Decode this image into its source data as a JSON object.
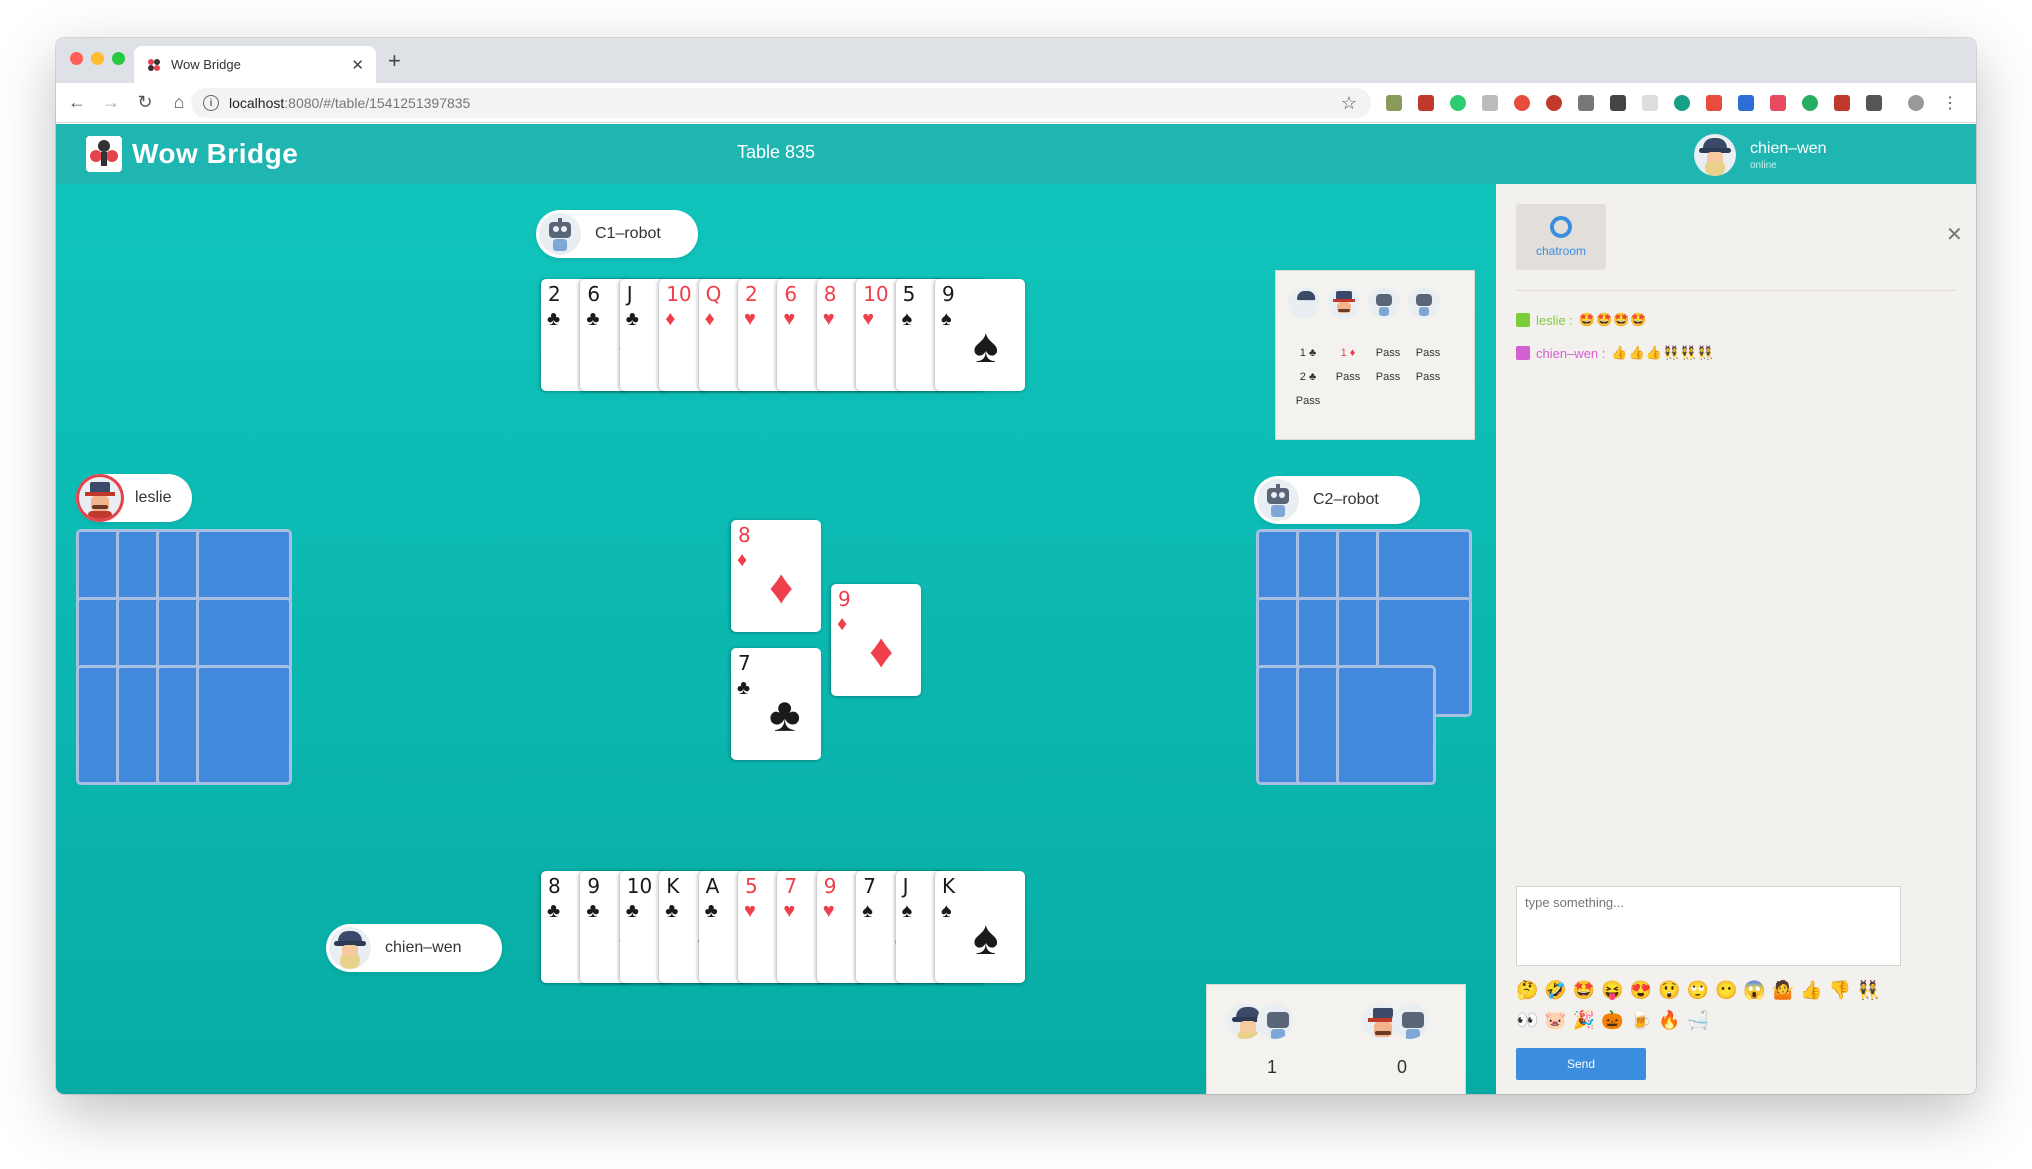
{
  "browser": {
    "tab_title": "Wow Bridge",
    "url_host": "localhost",
    "url_path": ":8080/#/table/1541251397835"
  },
  "app": {
    "logo_text": "Wow Bridge",
    "table_title": "Table 835",
    "user": {
      "name": "chien–wen",
      "status": "online"
    }
  },
  "players": {
    "north": "C1–robot",
    "west": "leslie",
    "east": "C2–robot",
    "south": "chien–wen"
  },
  "north_hand": [
    {
      "rank": "2",
      "suit": "♣",
      "color": "black"
    },
    {
      "rank": "6",
      "suit": "♣",
      "color": "black"
    },
    {
      "rank": "J",
      "suit": "♣",
      "color": "black"
    },
    {
      "rank": "10",
      "suit": "♦",
      "color": "red"
    },
    {
      "rank": "Q",
      "suit": "♦",
      "color": "red"
    },
    {
      "rank": "2",
      "suit": "♥",
      "color": "red"
    },
    {
      "rank": "6",
      "suit": "♥",
      "color": "red"
    },
    {
      "rank": "8",
      "suit": "♥",
      "color": "red"
    },
    {
      "rank": "10",
      "suit": "♥",
      "color": "red"
    },
    {
      "rank": "5",
      "suit": "♠",
      "color": "black"
    },
    {
      "rank": "9",
      "suit": "♠",
      "color": "black"
    }
  ],
  "south_hand": [
    {
      "rank": "8",
      "suit": "♣",
      "color": "black"
    },
    {
      "rank": "9",
      "suit": "♣",
      "color": "black"
    },
    {
      "rank": "10",
      "suit": "♣",
      "color": "black"
    },
    {
      "rank": "K",
      "suit": "♣",
      "color": "black"
    },
    {
      "rank": "A",
      "suit": "♣",
      "color": "black"
    },
    {
      "rank": "5",
      "suit": "♥",
      "color": "red"
    },
    {
      "rank": "7",
      "suit": "♥",
      "color": "red"
    },
    {
      "rank": "9",
      "suit": "♥",
      "color": "red"
    },
    {
      "rank": "7",
      "suit": "♠",
      "color": "black"
    },
    {
      "rank": "J",
      "suit": "♠",
      "color": "black"
    },
    {
      "rank": "K",
      "suit": "♠",
      "color": "black"
    }
  ],
  "trick": {
    "north": {
      "rank": "8",
      "suit": "♦",
      "color": "red"
    },
    "east": {
      "rank": "9",
      "suit": "♦",
      "color": "red"
    },
    "south": {
      "rank": "7",
      "suit": "♣",
      "color": "black"
    }
  },
  "bidding": {
    "rows": [
      [
        "1 ♣",
        "1 ♦",
        "Pass",
        "Pass"
      ],
      [
        "2 ♣",
        "Pass",
        "Pass",
        "Pass"
      ],
      [
        "Pass",
        "",
        "",
        ""
      ]
    ]
  },
  "score": {
    "team1": "1",
    "team2": "0"
  },
  "chat": {
    "tab_label": "chatroom",
    "messages": [
      {
        "user": "leslie :",
        "text": "🤩🤩🤩🤩",
        "color": "#7ccd3a"
      },
      {
        "user": "chien–wen :",
        "text": "👍👍👍👯👯👯",
        "color": "#d45fcf"
      }
    ],
    "placeholder": "type something...",
    "emojis_row1": [
      "🤔",
      "🤣",
      "🤩",
      "😝",
      "😍",
      "😲",
      "🙄",
      "😶",
      "😱",
      "🤷",
      "👍",
      "👎",
      "👯"
    ],
    "emojis_row2": [
      "👀",
      "🐷",
      "🎉",
      "🎃",
      "🍺",
      "🔥",
      "🛁"
    ],
    "send_label": "Send"
  }
}
